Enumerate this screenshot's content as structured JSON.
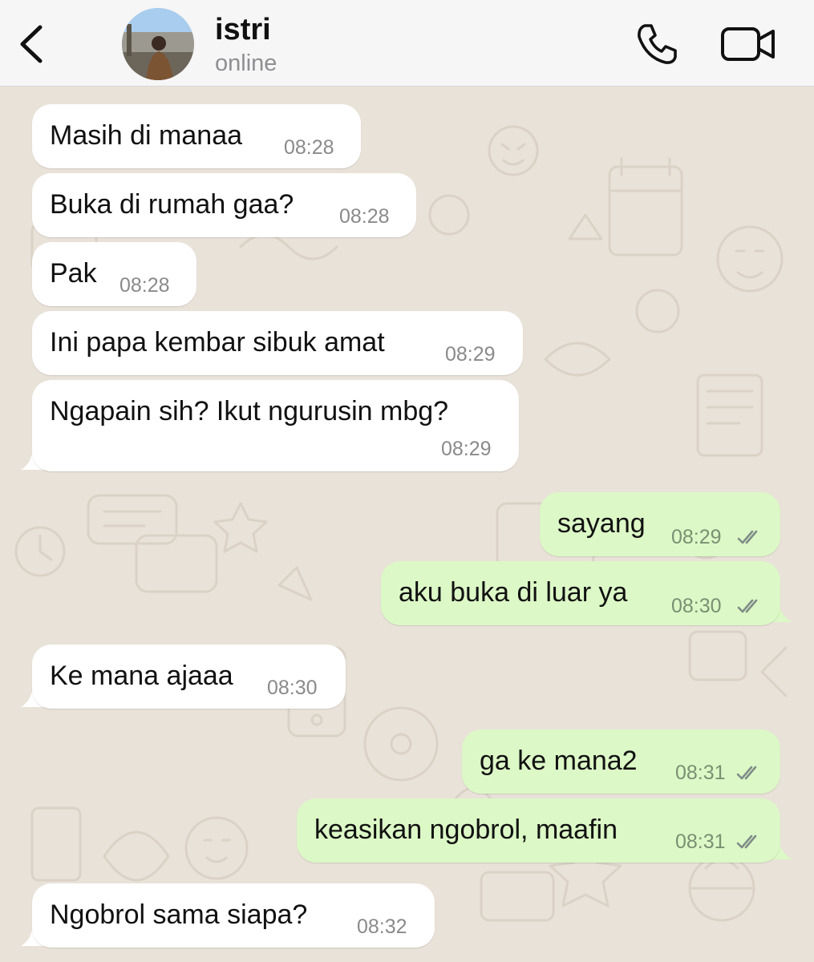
{
  "header": {
    "contact_name": "istri",
    "status": "online",
    "icons": {
      "back": "chevron-left-icon",
      "call": "phone-icon",
      "video": "video-camera-icon"
    }
  },
  "colors": {
    "incoming_bubble": "#ffffff",
    "outgoing_bubble": "#dcf8c6",
    "chat_background": "#e9e2d9",
    "header_background": "#f6f6f6"
  },
  "messages": [
    {
      "direction": "in",
      "text": "Masih di manaa",
      "time": "08:28"
    },
    {
      "direction": "in",
      "text": "Buka di rumah gaa?",
      "time": "08:28"
    },
    {
      "direction": "in",
      "text": "Pak",
      "time": "08:28"
    },
    {
      "direction": "in",
      "text": "Ini papa kembar sibuk amat",
      "time": "08:29"
    },
    {
      "direction": "in",
      "text": "Ngapain sih? Ikut ngurusin mbg?",
      "time": "08:29"
    },
    {
      "direction": "out",
      "text": "sayang",
      "time": "08:29",
      "status": "read"
    },
    {
      "direction": "out",
      "text": "aku buka di luar ya",
      "time": "08:30",
      "status": "read"
    },
    {
      "direction": "in",
      "text": "Ke mana ajaaa",
      "time": "08:30"
    },
    {
      "direction": "out",
      "text": "ga ke mana2",
      "time": "08:31",
      "status": "read"
    },
    {
      "direction": "out",
      "text": "keasikan ngobrol, maafin",
      "time": "08:31",
      "status": "read"
    },
    {
      "direction": "in",
      "text": "Ngobrol sama siapa?",
      "time": "08:32"
    }
  ]
}
